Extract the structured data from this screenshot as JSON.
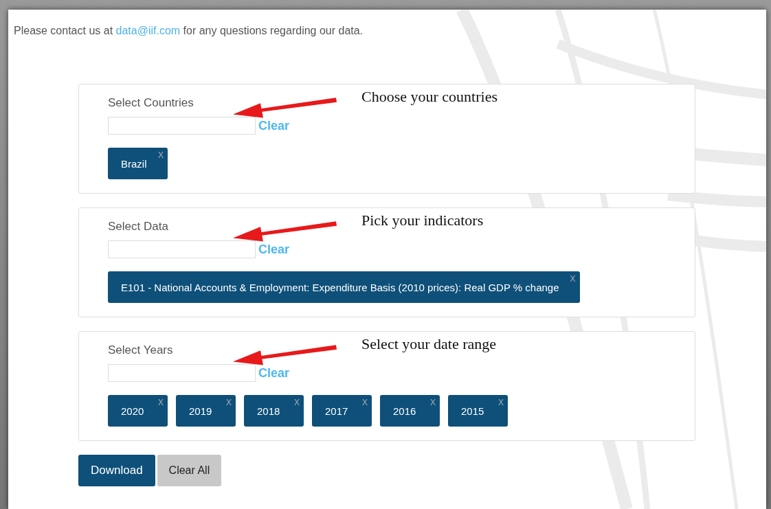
{
  "contact": {
    "text_before": "Please contact us at ",
    "link": "data@iif.com",
    "text_after": " for any questions regarding our data."
  },
  "sections": [
    {
      "label": "Select Countries",
      "clear": "Clear",
      "annotation": "Choose your countries",
      "tags": [
        {
          "text": "Brazil",
          "remove": "X"
        }
      ]
    },
    {
      "label": "Select Data",
      "clear": "Clear",
      "annotation": "Pick your indicators",
      "tags": [
        {
          "text": "E101 - National Accounts & Employment: Expenditure Basis (2010 prices): Real GDP % change",
          "remove": "X"
        }
      ]
    },
    {
      "label": "Select Years",
      "clear": "Clear",
      "annotation": "Select your date range",
      "tags": [
        {
          "text": "2020",
          "remove": "X"
        },
        {
          "text": "2019",
          "remove": "X"
        },
        {
          "text": "2018",
          "remove": "X"
        },
        {
          "text": "2017",
          "remove": "X"
        },
        {
          "text": "2016",
          "remove": "X"
        },
        {
          "text": "2015",
          "remove": "X"
        }
      ]
    }
  ],
  "buttons": [
    {
      "label": "Download",
      "kind": "primary"
    },
    {
      "label": "Clear All",
      "kind": "secondary"
    }
  ]
}
